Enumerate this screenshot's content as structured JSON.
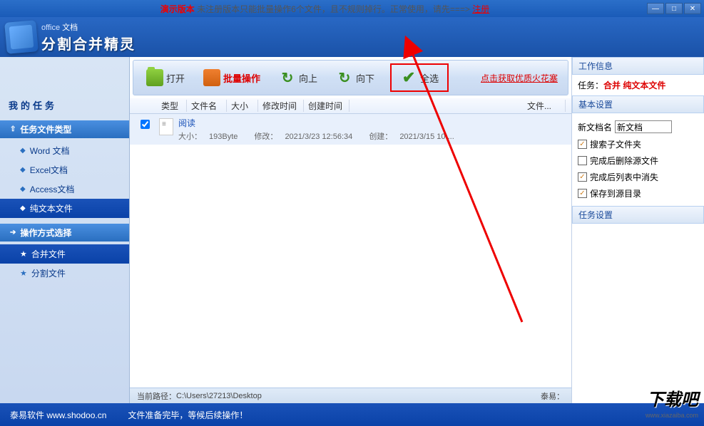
{
  "titlebar": {
    "demo_label": "演示版本",
    "demo_text": "未注册版本只能批量操作6个文件，且不规则掉行。正常使用，请先===>",
    "register": "注册"
  },
  "window_controls": {
    "min": "—",
    "max": "□",
    "close": "✕"
  },
  "header": {
    "logo_small_prefix": "office",
    "logo_small_suffix": "文档",
    "logo_main": "分割合并精灵"
  },
  "sidebar": {
    "title": "我的任务",
    "group1": {
      "header": "任务文件类型",
      "items": [
        {
          "label": "Word 文档"
        },
        {
          "label": "Excel文档"
        },
        {
          "label": "Access文档"
        },
        {
          "label": "纯文本文件"
        }
      ]
    },
    "group2": {
      "header": "操作方式选择",
      "items": [
        {
          "label": "合并文件"
        },
        {
          "label": "分割文件"
        }
      ]
    }
  },
  "toolbar": {
    "open": "打开",
    "batch": "批量操作",
    "up": "向上",
    "down": "向下",
    "select_all": "全选",
    "get_link": "点击获取优质火花塞"
  },
  "list": {
    "headers": {
      "type": "类型",
      "name": "文件名",
      "size": "大小",
      "modtime": "修改时间",
      "ctime": "创建时间",
      "file": "文件..."
    },
    "rows": [
      {
        "title": "阅读",
        "size_label": "大小：",
        "size": "193Byte",
        "mod_label": "修改：",
        "mod": "2021/3/23 12:56:34",
        "create_label": "创建：",
        "create": "2021/3/15 10:..."
      }
    ]
  },
  "path": {
    "label": "当前路径：",
    "value": "C:\\Users\\27213\\Desktop",
    "right": "泰易："
  },
  "right_panel": {
    "work_info": "工作信息",
    "task_prefix": "任务：",
    "task_value": "合并  纯文本文件",
    "basic_settings": "基本设置",
    "new_doc_label": "新文档名",
    "new_doc_value": "新文档",
    "cb_subfolders": "搜索子文件夹",
    "cb_delete_source": "完成后删除源文件",
    "cb_clear_list": "完成后列表中消失",
    "cb_save_source": "保存到源目录",
    "task_settings": "任务设置"
  },
  "footer": {
    "company": "泰易软件 www.shodoo.cn",
    "status": "文件准备完毕，等候后续操作！"
  },
  "watermark": {
    "text": "下载吧",
    "url": "www.xiazaiba.com"
  }
}
